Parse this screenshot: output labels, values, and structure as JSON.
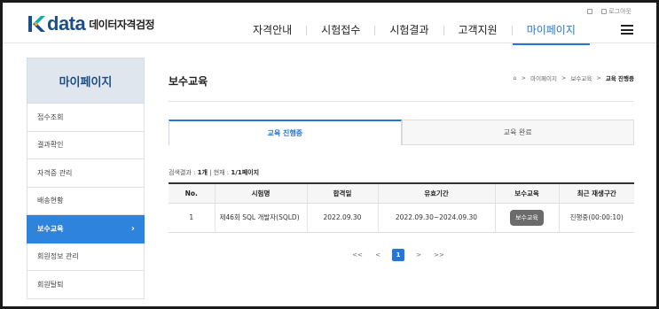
{
  "header": {
    "logo_word": "data",
    "logo_sub": "데이터자격검정",
    "util": [
      "",
      "로그아웃"
    ],
    "nav": [
      "자격안내",
      "시험접수",
      "시험결과",
      "고객지원",
      "마이페이지"
    ]
  },
  "sidebar": {
    "title": "마이페이지",
    "items": [
      {
        "label": "접수조회"
      },
      {
        "label": "결과확인"
      },
      {
        "label": "자격증 관리"
      },
      {
        "label": "배송현황"
      },
      {
        "label": "보수교육",
        "active": true
      },
      {
        "label": "회원정보 관리"
      },
      {
        "label": "회원탈퇴"
      }
    ]
  },
  "main": {
    "title": "보수교육",
    "breadcrumb": [
      "마이페이지",
      "보수교육",
      "교육 진행중"
    ],
    "tabs": [
      "교육 진행중",
      "교육 완료"
    ],
    "count": {
      "prefix": "검색결과 : ",
      "total": "1개",
      "sep": " | 현재 : ",
      "page": "1/1페이지"
    },
    "table": {
      "headers": [
        "No.",
        "시험명",
        "합격일",
        "유효기간",
        "보수교육",
        "최근 재생구간"
      ],
      "rows": [
        {
          "no": "1",
          "exam": "제46회 SQL 개발자(SQLD)",
          "pass_date": "2022.09.30",
          "valid": "2022.09.30~2024.09.30",
          "button": "보수교육",
          "last_play": "진행중(00:00:10)"
        }
      ]
    },
    "pager": {
      "first": "<<",
      "prev": "<",
      "current": "1",
      "next": ">",
      "last": ">>"
    }
  },
  "colors": {
    "accent": "#2477d4",
    "brand": "#1c4f8a",
    "logo_k": "#13b0a0"
  }
}
